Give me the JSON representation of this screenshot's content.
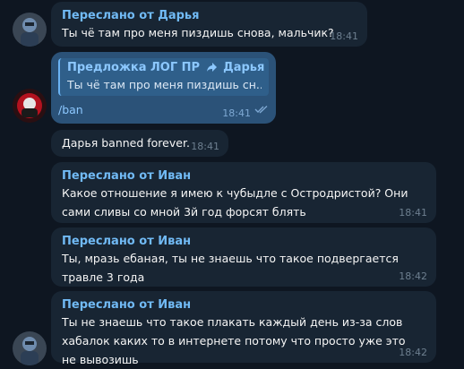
{
  "messages": [
    {
      "forwarded": "Переслано от Дарья",
      "text": "Ты чё там про меня пиздишь снова, мальчик?",
      "time": "18:41"
    },
    {
      "reply_title": "Предложка ЛОГ ПР",
      "reply_forward_from": "Дарья",
      "reply_text": "Ты чё там про меня пиздишь сн...",
      "text": "/ban",
      "time": "18:41"
    },
    {
      "text": "Дарья banned forever.",
      "time": "18:41"
    },
    {
      "forwarded": "Переслано от Иван",
      "text": "Какое отношение я имею к чубыдле с Остродристой? Они сами сливы со мной 3й год форсят блять",
      "time": "18:41"
    },
    {
      "forwarded": "Переслано от Иван",
      "text": "Ты, мразь ебаная, ты не знаешь что такое подвергается травле 3 года",
      "time": "18:42"
    },
    {
      "forwarded": "Переслано от Иван",
      "text": "Ты не знаешь что такое плакать каждый день из-за слов хабалок каких то в интернете потому что просто уже это не вывозишь",
      "time": "18:42"
    }
  ],
  "icons": {
    "avatar_1": "user-avatar",
    "avatar_2": "bot-avatar",
    "forward": "forward-arrow-icon",
    "read": "double-check-icon"
  },
  "colors": {
    "background": "#0e1621",
    "incoming_bubble": "#182533",
    "outgoing_bubble": "#2b5278",
    "accent": "#71baf5"
  }
}
